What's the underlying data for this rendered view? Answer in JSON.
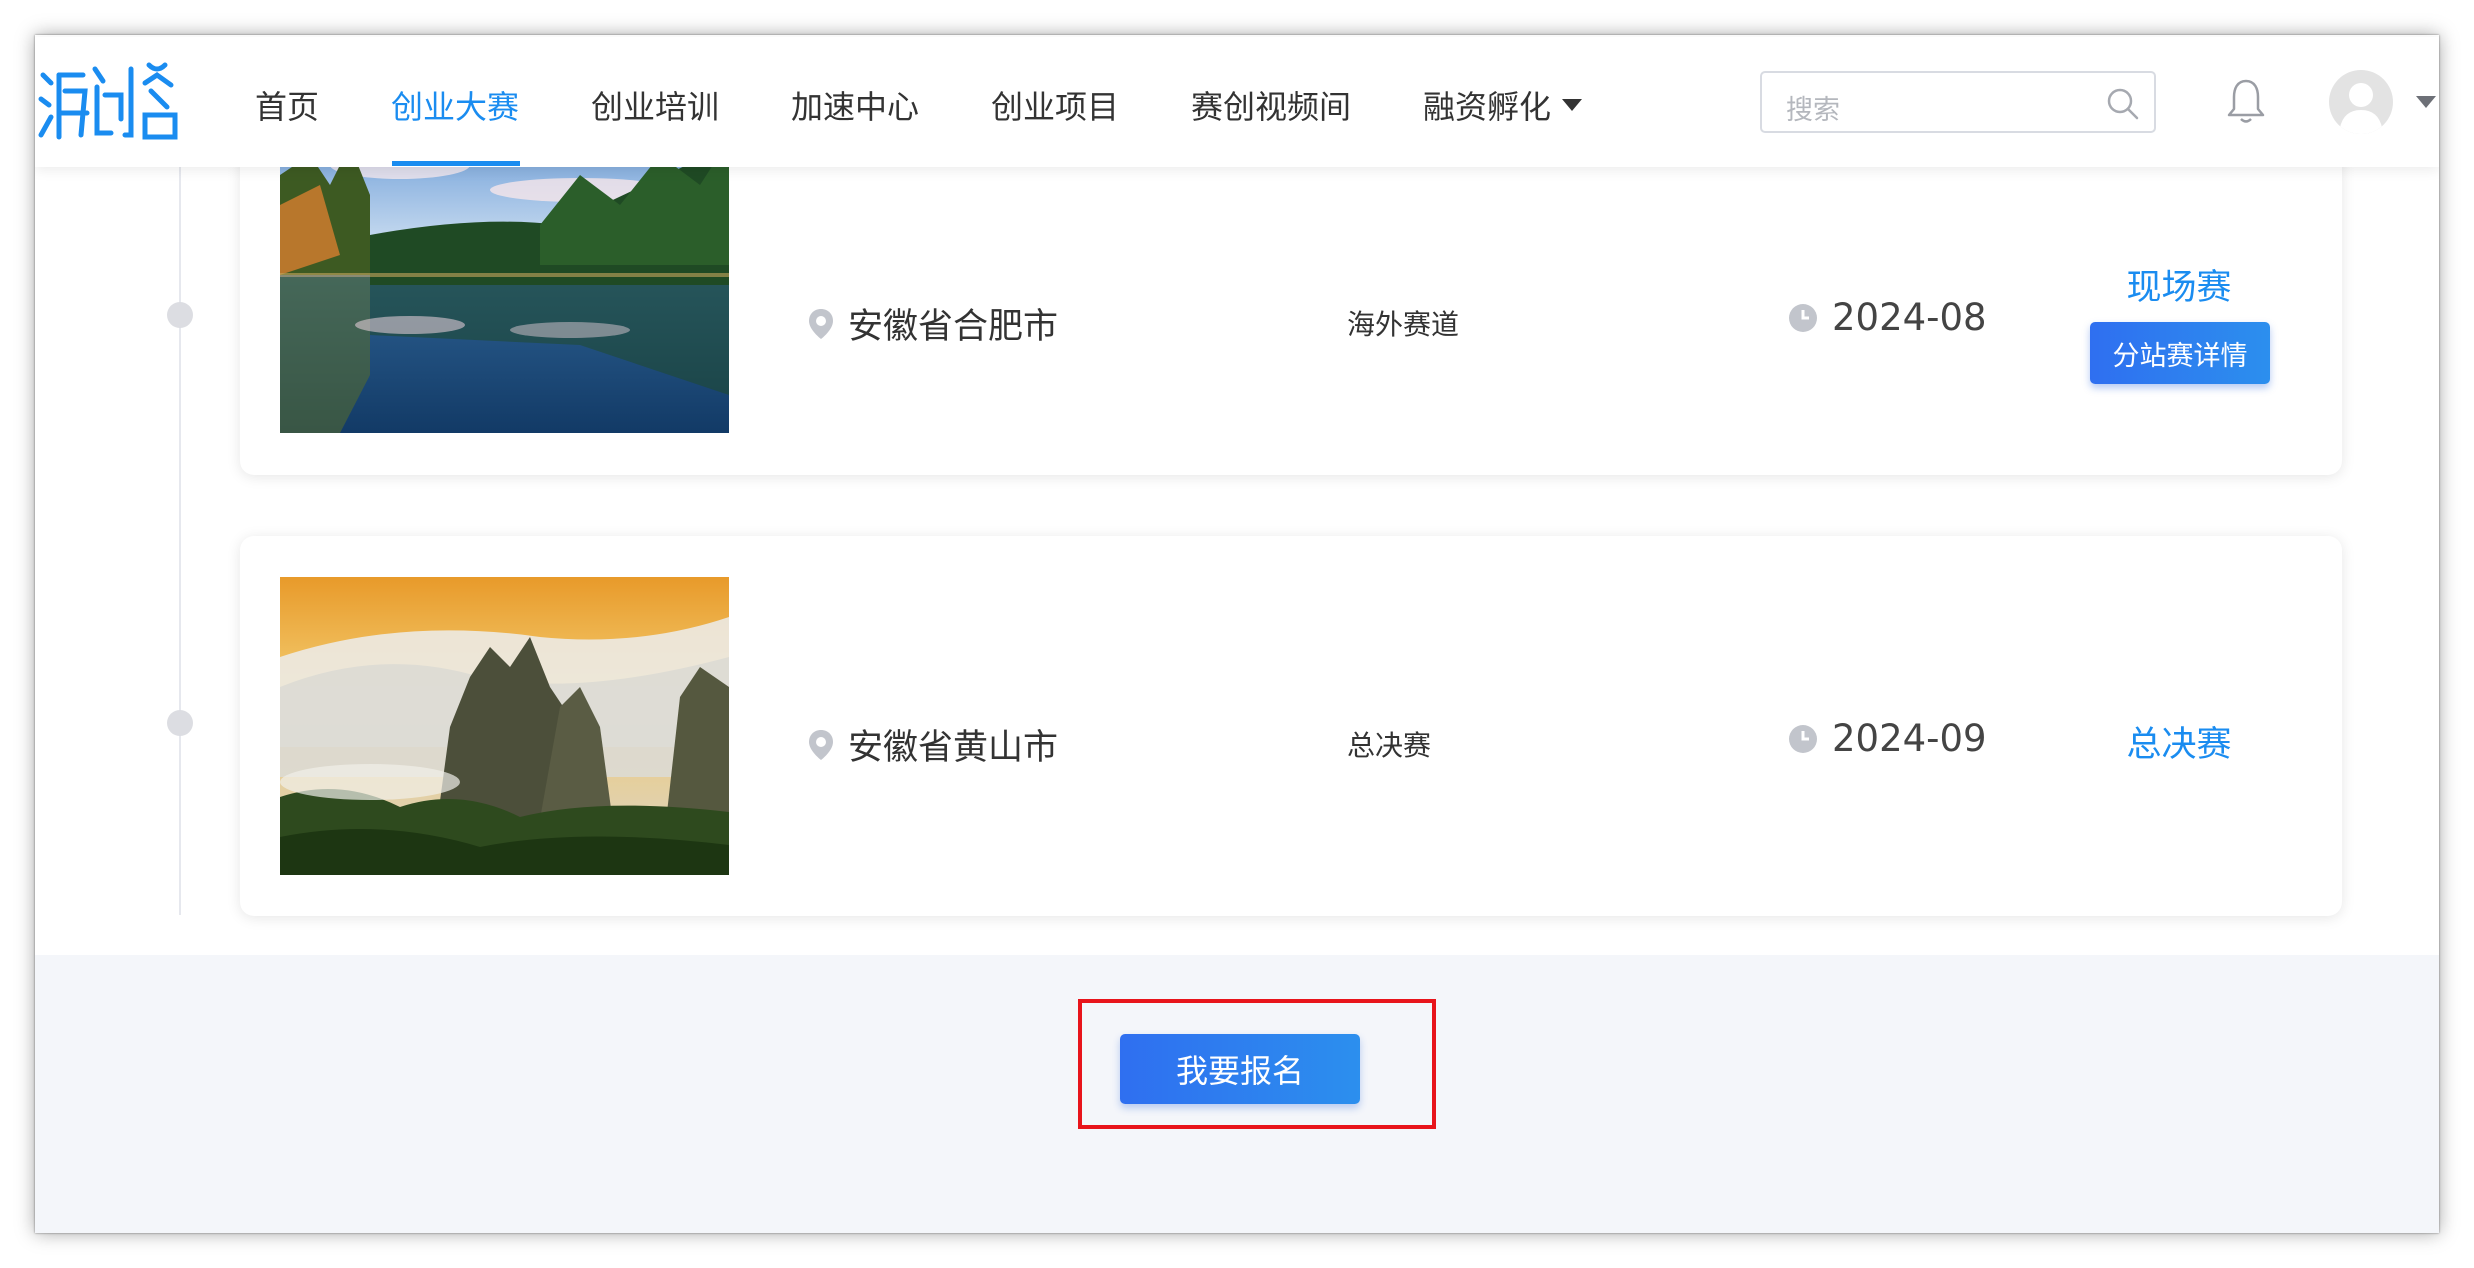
{
  "nav": {
    "items": [
      {
        "label": "首页"
      },
      {
        "label": "创业大赛"
      },
      {
        "label": "创业培训"
      },
      {
        "label": "加速中心"
      },
      {
        "label": "创业项目"
      },
      {
        "label": "赛创视频间"
      },
      {
        "label": "融资孵化"
      }
    ],
    "active_index": 1
  },
  "search": {
    "placeholder": "搜索"
  },
  "events": [
    {
      "location": "安徽省合肥市",
      "track": "海外赛道",
      "date": "2024-08",
      "stage": "现场赛",
      "detail_button": "分站赛详情"
    },
    {
      "location": "安徽省黄山市",
      "track": "总决赛",
      "date": "2024-09",
      "stage": "总决赛"
    }
  ],
  "signup": {
    "button_label": "我要报名"
  },
  "colors": {
    "accent": "#1a8cf0",
    "button": "#2f7ff0",
    "highlight": "#e8141b"
  },
  "icons": [
    "logo-icon",
    "search-icon",
    "bell-icon",
    "avatar-icon",
    "chevron-down-icon",
    "location-pin-icon",
    "clock-icon"
  ]
}
